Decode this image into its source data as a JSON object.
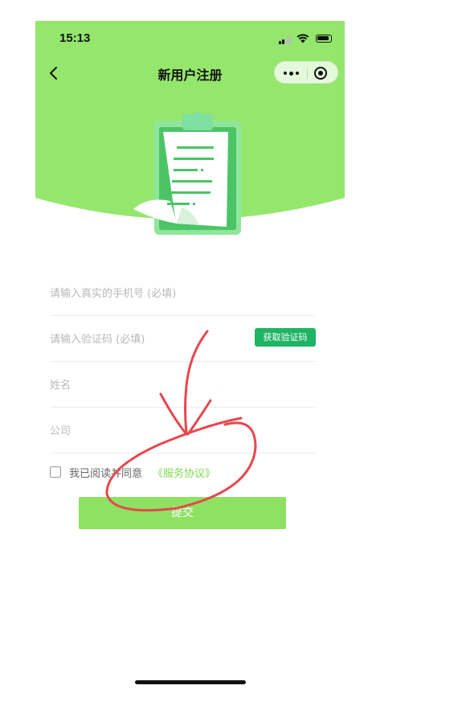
{
  "status_bar": {
    "time": "15:13"
  },
  "nav": {
    "title": "新用户注册"
  },
  "colors": {
    "theme_green": "#95e66d",
    "button_green": "#1fb464",
    "link_green": "#7ddb4f",
    "annotation_red": "#e5484d"
  },
  "form": {
    "phone_placeholder": "请输入真实的手机号 (必填)",
    "code_placeholder": "请输入验证码 (必填)",
    "get_code_label": "获取验证码",
    "name_placeholder": "姓名",
    "company_placeholder": "公司"
  },
  "agreement": {
    "text": "我已阅读并同意",
    "link": "《服务协议》",
    "checked": false
  },
  "submit_label": "提交"
}
